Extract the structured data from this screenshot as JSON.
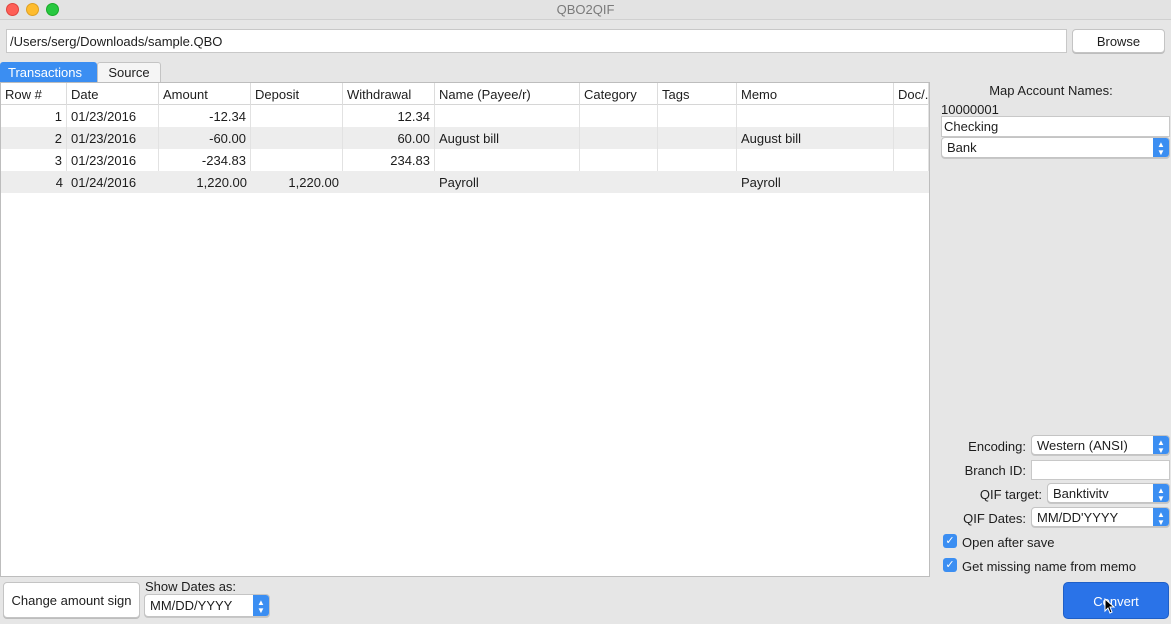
{
  "window": {
    "title": "QBO2QIF"
  },
  "toolbar": {
    "file_path": "/Users/serg/Downloads/sample.QBO",
    "browse_label": "Browse"
  },
  "tabs": [
    {
      "label": "Transactions",
      "active": true
    },
    {
      "label": "Source",
      "active": false
    }
  ],
  "table": {
    "columns": [
      "Row #",
      "Date",
      "Amount",
      "Deposit",
      "Withdrawal",
      "Name (Payee/r)",
      "Category",
      "Tags",
      "Memo",
      "Doc/."
    ],
    "rows": [
      {
        "row": "1",
        "date": "01/23/2016",
        "amount": "-12.34",
        "deposit": "",
        "withdrawal": "12.34",
        "name": "",
        "category": "",
        "tags": "",
        "memo": "",
        "doc": ""
      },
      {
        "row": "2",
        "date": "01/23/2016",
        "amount": "-60.00",
        "deposit": "",
        "withdrawal": "60.00",
        "name": "August bill",
        "category": "",
        "tags": "",
        "memo": "August bill",
        "doc": ""
      },
      {
        "row": "3",
        "date": "01/23/2016",
        "amount": "-234.83",
        "deposit": "",
        "withdrawal": "234.83",
        "name": "",
        "category": "",
        "tags": "",
        "memo": "",
        "doc": ""
      },
      {
        "row": "4",
        "date": "01/24/2016",
        "amount": "1,220.00",
        "deposit": "1,220.00",
        "withdrawal": "",
        "name": "Payroll",
        "category": "",
        "tags": "",
        "memo": "Payroll",
        "doc": ""
      }
    ]
  },
  "right_panel": {
    "map_title": "Map Account Names:",
    "account_number": "10000001",
    "account_name": "Checking",
    "account_type": "Bank",
    "encoding_label": "Encoding:",
    "encoding_value": "Western (ANSI)",
    "branch_label": "Branch ID:",
    "branch_value": "",
    "qif_target_label": "QIF target:",
    "qif_target_value": "Banktivitv",
    "qif_dates_label": "QIF Dates:",
    "qif_dates_value": "MM/DD'YYYY",
    "open_after_save_label": "Open after save",
    "open_after_save_checked": true,
    "get_missing_name_label": "Get missing name from memo",
    "get_missing_name_checked": true
  },
  "bottom": {
    "change_sign_label": "Change amount sign",
    "show_dates_label": "Show Dates as:",
    "show_dates_value": "MM/DD/YYYY",
    "convert_label": "Convert"
  },
  "icons": {
    "checkmark": "✓",
    "select_arrows": "▲▼"
  },
  "colors": {
    "accent": "#3b8ef2",
    "convert": "#2a73e8"
  }
}
